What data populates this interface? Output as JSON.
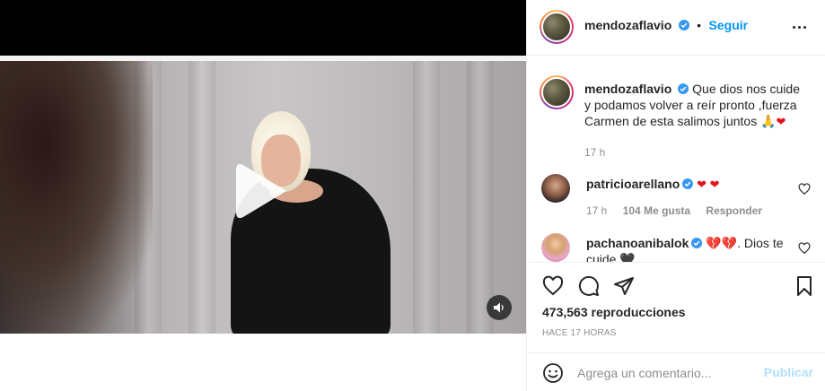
{
  "post": {
    "author": "mendozaflavio",
    "follow_label": "Seguir",
    "separator": "•",
    "caption": "Que dios nos cuide y podamos volver a reír pronto ,fuerza Carmen de esta salimos juntos",
    "caption_emoji": "🙏",
    "caption_heart": "❤",
    "caption_age": "17 h"
  },
  "comments": [
    {
      "author": "patricioarellano",
      "text": "❤ ❤",
      "age": "17 h",
      "likes": "104 Me gusta",
      "reply_label": "Responder"
    },
    {
      "author": "pachanoanibalok",
      "text_hearts": "💔💔",
      "text": ". Dios",
      "text_cut": "te cuide 🖤"
    }
  ],
  "stats": {
    "views": "473,563 reproducciones",
    "time_ago": "HACE 17 HORAS"
  },
  "composer": {
    "placeholder": "Agrega un comentario...",
    "publish_label": "Publicar"
  },
  "colors": {
    "accent": "#0095f6",
    "publish_disabled": "#b2dffc",
    "muted_text": "#8e8e8e",
    "primary_text": "#262626",
    "verified_badge": "#3897f0"
  },
  "icons": {
    "play": "play-icon",
    "audio": "speaker-icon",
    "more": "more-options-icon",
    "like": "heart-outline-icon",
    "comment": "comment-bubble-icon",
    "share": "paper-plane-icon",
    "save": "bookmark-icon",
    "emoji": "smiley-icon",
    "verified": "verified-badge-icon"
  }
}
